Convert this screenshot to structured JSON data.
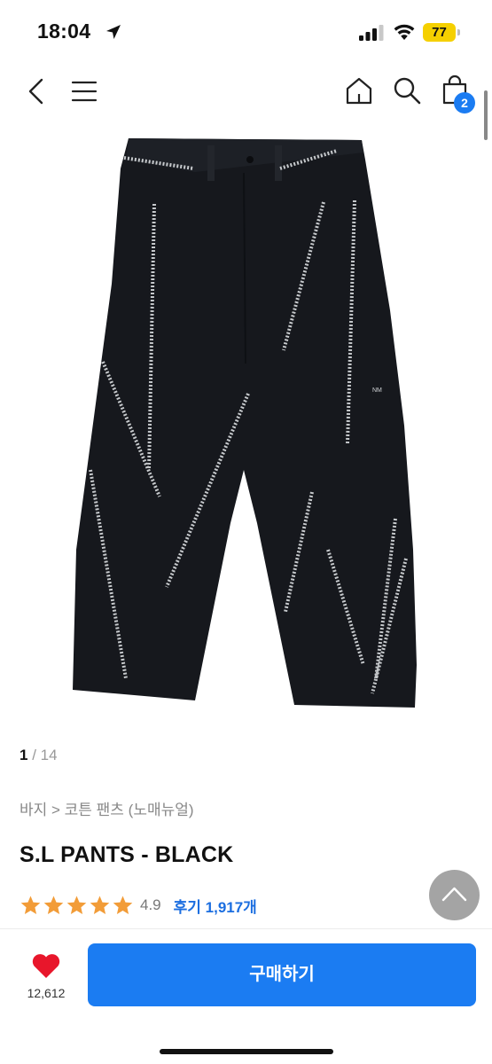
{
  "status_bar": {
    "time": "18:04",
    "battery": "77",
    "icons": [
      "location-arrow-icon",
      "signal-icon",
      "wifi-icon",
      "battery-icon"
    ],
    "battery_color": "#f5d000"
  },
  "nav": {
    "icons": [
      "back-icon",
      "menu-icon",
      "home-icon",
      "search-icon",
      "cart-icon"
    ],
    "cart_count": "2",
    "badge_color": "#1b7cf2"
  },
  "gallery": {
    "current": "1",
    "separator": "/",
    "total": "14",
    "image": "black-pants-product-photo"
  },
  "product": {
    "breadcrumb": "바지 > 코튼 팬츠 (노매뉴얼)",
    "name": "S.L PANTS - BLACK",
    "rating": "4.9",
    "rating_stars": 5,
    "reviews": "후기 1,917개",
    "star_color": "#f29c38"
  },
  "bottom": {
    "like_count": "12,612",
    "heart_color": "#e8162b",
    "buy_label": "구매하기",
    "buy_color": "#1b7cf2"
  }
}
